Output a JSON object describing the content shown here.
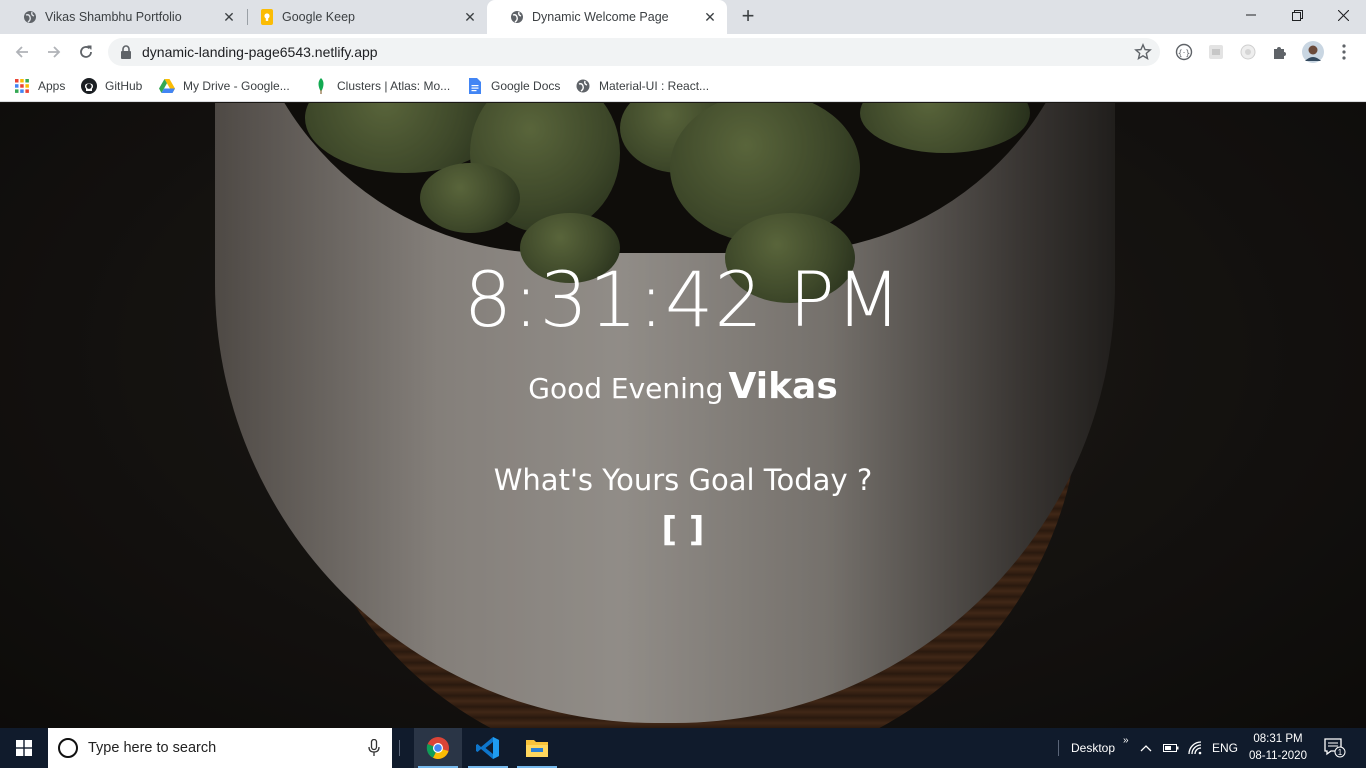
{
  "browser": {
    "tabs": [
      {
        "title": "Vikas Shambhu Portfolio",
        "icon": "globe-icon",
        "active": false
      },
      {
        "title": "Google Keep",
        "icon": "google-keep-icon",
        "active": false
      },
      {
        "title": "Dynamic Welcome Page",
        "icon": "globe-icon",
        "active": true
      }
    ],
    "url": "dynamic-landing-page6543.netlify.app",
    "bookmarks": [
      {
        "label": "Apps",
        "icon": "apps-grid-icon"
      },
      {
        "label": "GitHub",
        "icon": "github-icon"
      },
      {
        "label": "My Drive - Google...",
        "icon": "google-drive-icon"
      },
      {
        "label": "Clusters | Atlas: Mo...",
        "icon": "mongodb-leaf-icon"
      },
      {
        "label": "Google Docs",
        "icon": "google-docs-icon"
      },
      {
        "label": "Material-UI : React...",
        "icon": "globe-icon"
      }
    ]
  },
  "page": {
    "time": "8:31:42 PM",
    "greeting": "Good Evening",
    "name": "Vikas",
    "goal_question": "What's Yours Goal Today ?",
    "goal_value": "[ ]"
  },
  "taskbar": {
    "search_placeholder": "Type here to search",
    "desktop_label": "Desktop",
    "language": "ENG",
    "time": "08:31 PM",
    "date": "08-11-2020",
    "notification_count": "1"
  },
  "colors": {
    "tabstrip": "#dee1e6",
    "taskbar": "#101b2c",
    "accent_underline": "#76b9ed"
  }
}
